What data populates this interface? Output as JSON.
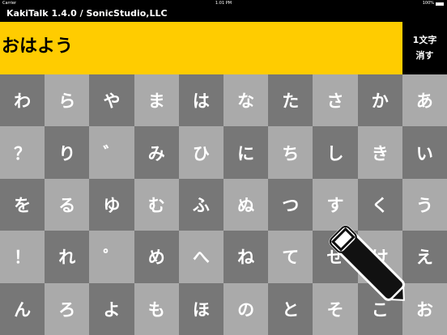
{
  "status_bar": {
    "carrier": "Carrier",
    "time": "1:01 PM",
    "battery": "100%"
  },
  "app_title": "KakiTalk 1.4.0 / SonicStudio,LLC",
  "display_text": "おはよう",
  "delete_button": {
    "line1": "1文字",
    "line2": "消す"
  },
  "keyboard_rows": [
    [
      "わ",
      "ら",
      "や",
      "ま",
      "は",
      "な",
      "た",
      "さ",
      "か",
      "あ"
    ],
    [
      "？",
      "り",
      "゛",
      "み",
      "ひ",
      "に",
      "ち",
      "し",
      "き",
      "い"
    ],
    [
      "を",
      "る",
      "ゆ",
      "む",
      "ふ",
      "ぬ",
      "つ",
      "す",
      "く",
      "う"
    ],
    [
      "！",
      "れ",
      "゜",
      "め",
      "へ",
      "ね",
      "て",
      "せ",
      "け",
      "え"
    ],
    [
      "ん",
      "ろ",
      "よ",
      "も",
      "ほ",
      "の",
      "と",
      "そ",
      "こ",
      "お"
    ]
  ],
  "colors": {
    "key_dark": "#777777",
    "key_light": "#aaaaaa",
    "display_bg": "#ffcc00",
    "title_bg": "#000000"
  },
  "overlay_icon": "pen-icon"
}
